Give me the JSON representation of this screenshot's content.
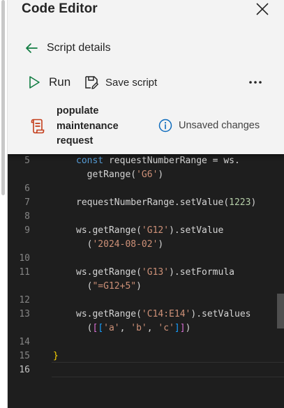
{
  "header": {
    "title": "Code Editor",
    "back_label": "Script details",
    "run_label": "Run",
    "save_label": "Save script",
    "script_name_lines": [
      "populate",
      "maintenance",
      "request"
    ],
    "unsaved_label": "Unsaved changes"
  },
  "icons": {
    "close": "close-icon",
    "back": "arrow-left-icon",
    "run": "play-icon",
    "save": "save-script-icon",
    "more": "more-horizontal-icon",
    "script": "script-file-icon",
    "info": "info-icon"
  },
  "colors": {
    "accent_green": "#107c41",
    "script_icon_orange": "#c43e1c",
    "info_blue": "#0f6cbd",
    "editor_bg": "#1e1e1e"
  },
  "editor": {
    "lines": [
      {
        "num": "5",
        "code": [
          {
            "t": "const ",
            "c": "kw"
          },
          {
            "t": "requestNumberRange = ws."
          }
        ]
      },
      {
        "num": "",
        "code": [
          {
            "t": "  getRange("
          },
          {
            "t": "'G6'",
            "c": "str"
          },
          {
            "t": ")"
          }
        ]
      },
      {
        "num": "6",
        "code": []
      },
      {
        "num": "7",
        "code": [
          {
            "t": "requestNumberRange.setValue("
          },
          {
            "t": "1223",
            "c": "num"
          },
          {
            "t": ")"
          }
        ]
      },
      {
        "num": "8",
        "code": []
      },
      {
        "num": "9",
        "code": [
          {
            "t": "ws.getRange("
          },
          {
            "t": "'G12'",
            "c": "str"
          },
          {
            "t": ").setValue"
          }
        ]
      },
      {
        "num": "",
        "code": [
          {
            "t": "  ("
          },
          {
            "t": "'2024-08-02'",
            "c": "str"
          },
          {
            "t": ")"
          }
        ]
      },
      {
        "num": "10",
        "code": []
      },
      {
        "num": "11",
        "code": [
          {
            "t": "ws.getRange("
          },
          {
            "t": "'G13'",
            "c": "str"
          },
          {
            "t": ").setFormula"
          }
        ]
      },
      {
        "num": "",
        "code": [
          {
            "t": "  ("
          },
          {
            "t": "\"=G12+5\"",
            "c": "str"
          },
          {
            "t": ")"
          }
        ]
      },
      {
        "num": "12",
        "code": []
      },
      {
        "num": "13",
        "code": [
          {
            "t": "ws.getRange("
          },
          {
            "t": "'C14:E14'",
            "c": "str"
          },
          {
            "t": ").setValues"
          }
        ]
      },
      {
        "num": "",
        "code": [
          {
            "t": "  ("
          },
          {
            "t": "[",
            "c": "b2"
          },
          {
            "t": "[",
            "c": "b3"
          },
          {
            "t": "'a'",
            "c": "str"
          },
          {
            "t": ", "
          },
          {
            "t": "'b'",
            "c": "str"
          },
          {
            "t": ", "
          },
          {
            "t": "'c'",
            "c": "str"
          },
          {
            "t": "]",
            "c": "b3"
          },
          {
            "t": "]",
            "c": "b2"
          },
          {
            "t": ")"
          }
        ]
      },
      {
        "num": "14",
        "code": []
      },
      {
        "num": "15",
        "code": [
          {
            "t": "}",
            "c": "brace",
            "x": 0
          }
        ]
      },
      {
        "num": "16",
        "code": [],
        "active": true
      }
    ]
  }
}
